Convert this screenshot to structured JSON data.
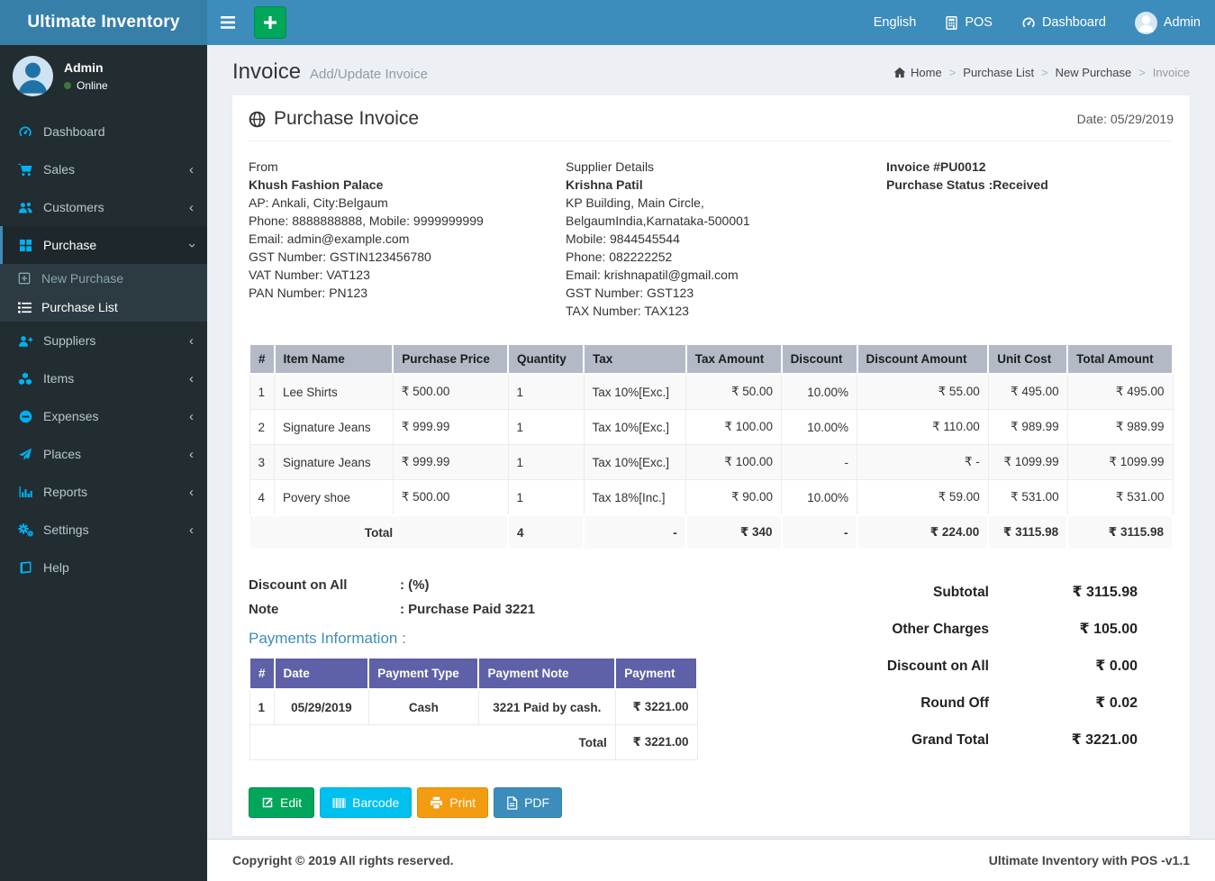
{
  "brand": "Ultimate Inventory",
  "topnav": {
    "language": "English",
    "pos_label": "POS",
    "dashboard_label": "Dashboard",
    "user_label": "Admin"
  },
  "sidebar": {
    "user_name": "Admin",
    "user_status": "Online",
    "items": [
      {
        "label": "Dashboard"
      },
      {
        "label": "Sales"
      },
      {
        "label": "Customers"
      },
      {
        "label": "Purchase"
      },
      {
        "label": "Suppliers"
      },
      {
        "label": "Items"
      },
      {
        "label": "Expenses"
      },
      {
        "label": "Places"
      },
      {
        "label": "Reports"
      },
      {
        "label": "Settings"
      },
      {
        "label": "Help"
      }
    ],
    "purchase_submenu": [
      {
        "label": "New Purchase"
      },
      {
        "label": "Purchase List"
      }
    ]
  },
  "page": {
    "title": "Invoice",
    "subtitle": "Add/Update Invoice",
    "breadcrumb": [
      {
        "label": "Home"
      },
      {
        "label": "Purchase List"
      },
      {
        "label": "New Purchase"
      },
      {
        "label": "Invoice"
      }
    ]
  },
  "invoice": {
    "section_title": "Purchase Invoice",
    "date": "Date: 05/29/2019",
    "from": {
      "heading": "From",
      "name": "Khush Fashion Palace",
      "lines": [
        "AP: Ankali, City:Belgaum",
        "Phone: 8888888888, Mobile: 9999999999",
        "Email: admin@example.com",
        "GST Number: GSTIN123456780",
        "VAT Number: VAT123",
        "PAN Number: PN123"
      ]
    },
    "supplier": {
      "heading": "Supplier Details",
      "name": "Krishna Patil",
      "lines": [
        "KP Building, Main Circle, BelgaumIndia,Karnataka-500001",
        "Mobile: 9844545544",
        "Phone: 082222252",
        "Email: krishnapatil@gmail.com",
        "GST Number: GST123",
        "TAX Number: TAX123"
      ]
    },
    "meta": {
      "number": "Invoice #PU0012",
      "status": "Purchase Status :Received"
    },
    "items_table": {
      "headers": [
        "#",
        "Item Name",
        "Purchase Price",
        "Quantity",
        "Tax",
        "Tax Amount",
        "Discount",
        "Discount Amount",
        "Unit Cost",
        "Total Amount"
      ],
      "rows": [
        [
          "1",
          "Lee Shirts",
          "₹ 500.00",
          "1",
          "Tax 10%[Exc.]",
          "₹ 50.00",
          "10.00%",
          "₹ 55.00",
          "₹ 495.00",
          "₹ 495.00"
        ],
        [
          "2",
          "Signature Jeans",
          "₹ 999.99",
          "1",
          "Tax 10%[Exc.]",
          "₹ 100.00",
          "10.00%",
          "₹ 110.00",
          "₹ 989.99",
          "₹ 989.99"
        ],
        [
          "3",
          "Signature Jeans",
          "₹ 999.99",
          "1",
          "Tax 10%[Exc.]",
          "₹ 100.00",
          "-",
          "₹ -",
          "₹ 1099.99",
          "₹ 1099.99"
        ],
        [
          "4",
          "Povery shoe",
          "₹ 500.00",
          "1",
          "Tax 18%[Inc.]",
          "₹ 90.00",
          "10.00%",
          "₹ 59.00",
          "₹ 531.00",
          "₹ 531.00"
        ]
      ],
      "total": {
        "label": "Total",
        "qty": "4",
        "tax": "-",
        "tax_amount": "₹ 340",
        "discount": "-",
        "discount_amount": "₹ 224.00",
        "unit_cost": "₹ 3115.98",
        "total_amount": "₹ 3115.98"
      }
    },
    "discount_label": "Discount on All",
    "discount_value": ": (%)",
    "note_label": "Note",
    "note_value": ": Purchase Paid 3221",
    "payments": {
      "title": "Payments Information :",
      "headers": [
        "#",
        "Date",
        "Payment Type",
        "Payment Note",
        "Payment"
      ],
      "rows": [
        [
          "1",
          "05/29/2019",
          "Cash",
          "3221 Paid by cash.",
          "₹ 3221.00"
        ]
      ],
      "total_label": "Total",
      "total_value": "₹ 3221.00"
    },
    "summary": [
      {
        "label": "Subtotal",
        "value": "₹ 3115.98"
      },
      {
        "label": "Other Charges",
        "value": "₹ 105.00"
      },
      {
        "label": "Discount on All",
        "value": "₹ 0.00"
      },
      {
        "label": "Round Off",
        "value": "₹ 0.02"
      },
      {
        "label": "Grand Total",
        "value": "₹ 3221.00"
      }
    ],
    "buttons": [
      {
        "label": "Edit"
      },
      {
        "label": "Barcode"
      },
      {
        "label": "Print"
      },
      {
        "label": "PDF"
      }
    ]
  },
  "footer": {
    "left": "Copyright © 2019 All rights reserved.",
    "right": "Ultimate Inventory with POS -v1.1"
  },
  "colors": {
    "navbar": "#3c8dbc",
    "logo_bar": "#367fa9",
    "sidebar": "#222d32",
    "sidebar_icon": "#00b1f1",
    "accent_green": "#00a65a",
    "accent_cyan": "#00c0ef",
    "accent_orange": "#f39c12",
    "accent_blue": "#3c8dbc",
    "items_header_bg": "#b3bac6",
    "items_total_bg": "#ccd1dc",
    "payments_header_bg": "#5e60a8",
    "online_status": "#3c763d"
  }
}
